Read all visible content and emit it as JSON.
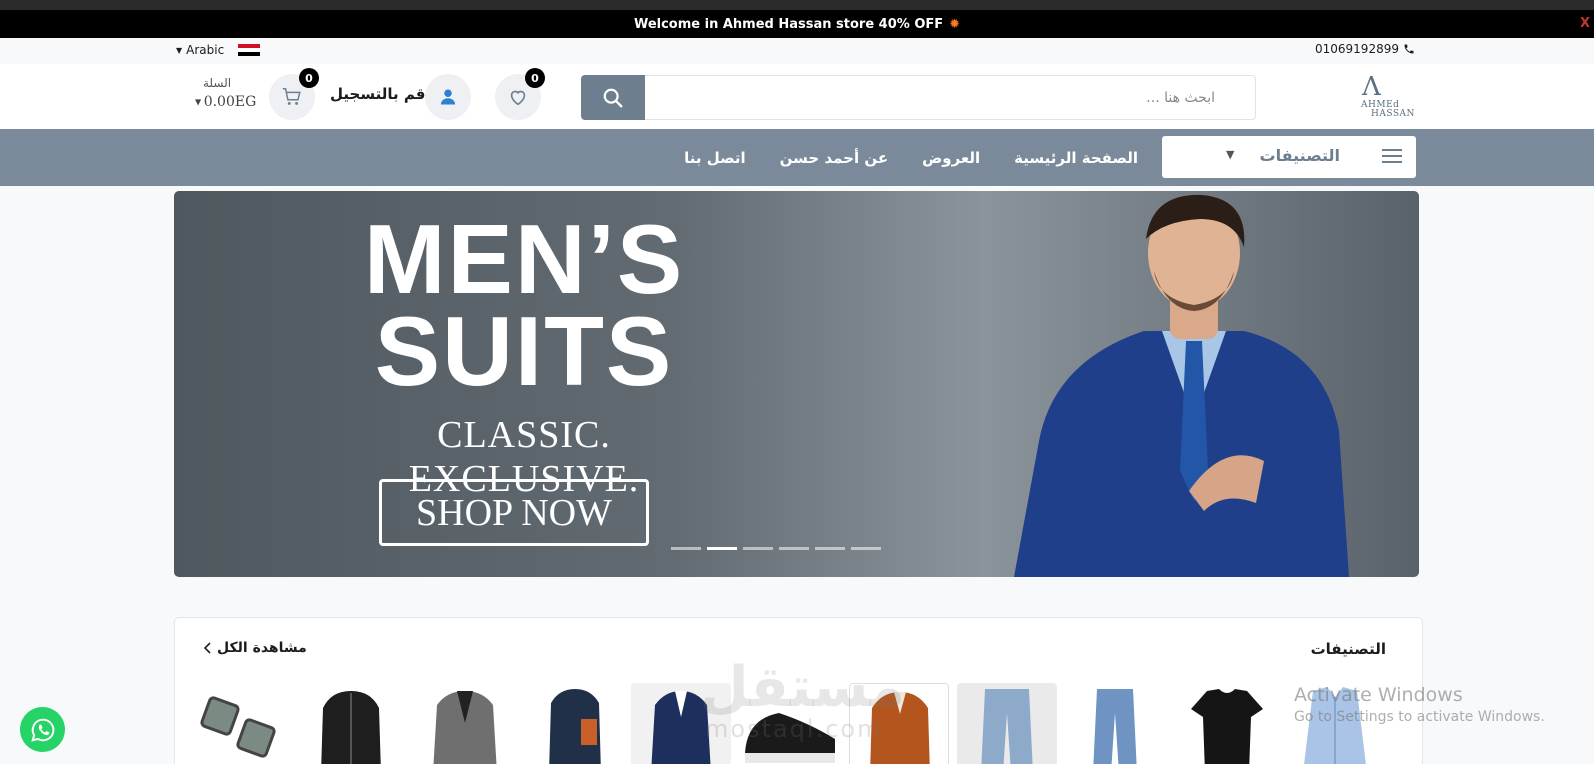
{
  "promo": {
    "text": "Welcome in Ahmed Hassan store 40% OFF",
    "close": "X"
  },
  "infobar": {
    "language": "Arabic",
    "phone": "01069192899"
  },
  "logo": {
    "line1": "AHMEd",
    "line2": "HASSAN"
  },
  "search": {
    "placeholder": "ابحث هنا ..."
  },
  "header": {
    "wishlist_count": "0",
    "login_label": "قم بالتسجيل",
    "cart_count": "0",
    "cart_label": "السلة",
    "cart_total": "0.00EG"
  },
  "nav": {
    "categories_label": "التصنيفات",
    "links": [
      "الصفحة الرئيسية",
      "العروض",
      "عن أحمد حسن",
      "اتصل بنا"
    ]
  },
  "hero": {
    "title_line1": "MEN’S",
    "title_line2": "SUITS",
    "subtitle": "CLASSIC. EXCLUSIVE.",
    "cta": "SHOP NOW",
    "slides": 6,
    "active_slide": 2
  },
  "categories": {
    "title": "التصنيفات",
    "view_all": "مشاهدة الكل"
  },
  "watermark": {
    "arabic": "مستقل",
    "latin": "mostaql.com"
  },
  "os_overlay": {
    "line1": "Activate Windows",
    "line2": "Go to Settings to activate Windows."
  },
  "colors": {
    "accent": "#7a8a9a",
    "promo_bg": "#000000",
    "whatsapp": "#25d366",
    "badge": "#000000"
  }
}
